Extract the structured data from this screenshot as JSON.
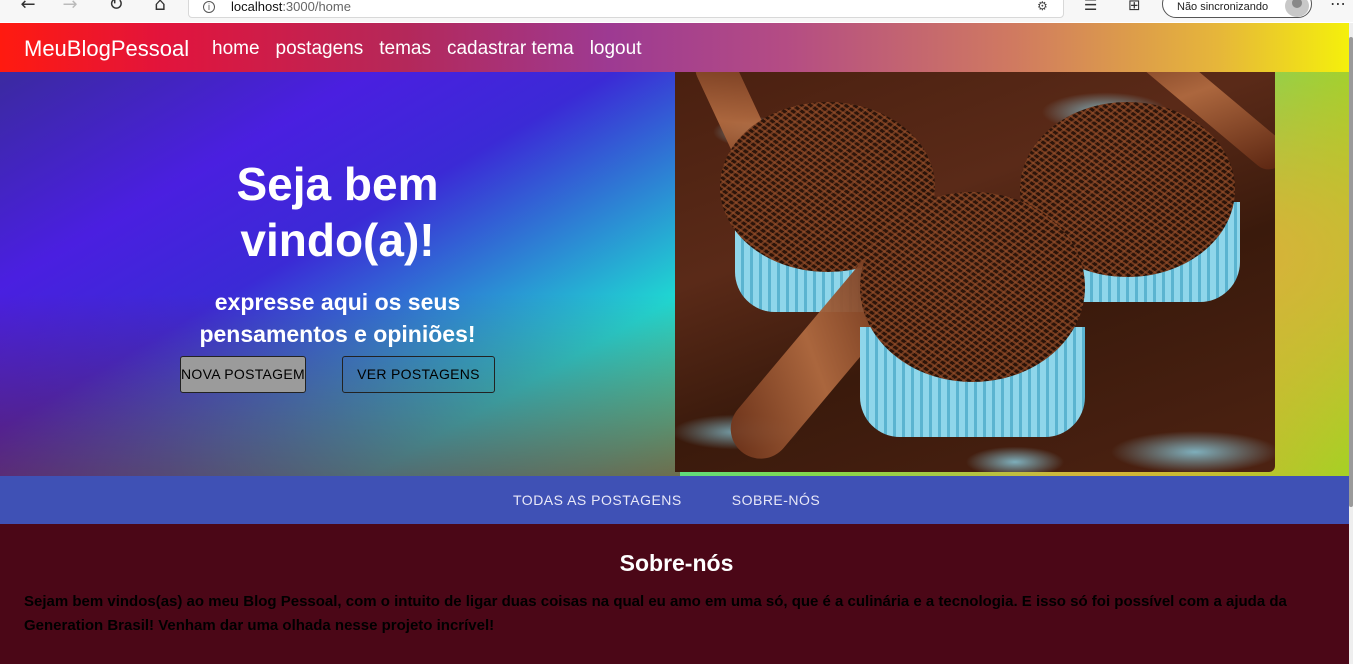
{
  "browser": {
    "url_host": "localhost",
    "url_path": ":3000/home",
    "sync_label": "Não sincronizando",
    "icons": [
      "back-arrow-icon",
      "forward-arrow-icon",
      "refresh-icon",
      "home-icon",
      "info-icon",
      "site-permissions-icon",
      "favorites-icon",
      "collections-icon",
      "profile-icon",
      "more-icon"
    ]
  },
  "header": {
    "brand": "MeuBlogPessoal",
    "nav": [
      {
        "label": "home"
      },
      {
        "label": "postagens"
      },
      {
        "label": "temas"
      },
      {
        "label": "cadastrar tema"
      },
      {
        "label": "logout"
      }
    ]
  },
  "hero": {
    "title": "Seja bem vindo(a)!",
    "subtitle": "expresse aqui os seus pensamentos e opiniões!",
    "primary_button": "NOVA POSTAGEM",
    "secondary_button": "VER POSTAGENS"
  },
  "tabs": [
    {
      "label": "TODAS AS POSTAGENS"
    },
    {
      "label": "SOBRE-NÓS"
    }
  ],
  "about": {
    "title": "Sobre-nós",
    "text": "Sejam bem vindos(as) ao meu Blog Pessoal, com o intuito de ligar duas coisas na qual eu amo em uma só, que é a culinária e a tecnologia. E isso só foi possível com a ajuda da Generation Brasil! Venham dar uma olhada nesse projeto incrível!"
  },
  "colors": {
    "tabs_bar": "#3f51b5",
    "about_bg": "#4b0717",
    "header_start": "#ff1a10",
    "header_end": "#f5f20a"
  }
}
